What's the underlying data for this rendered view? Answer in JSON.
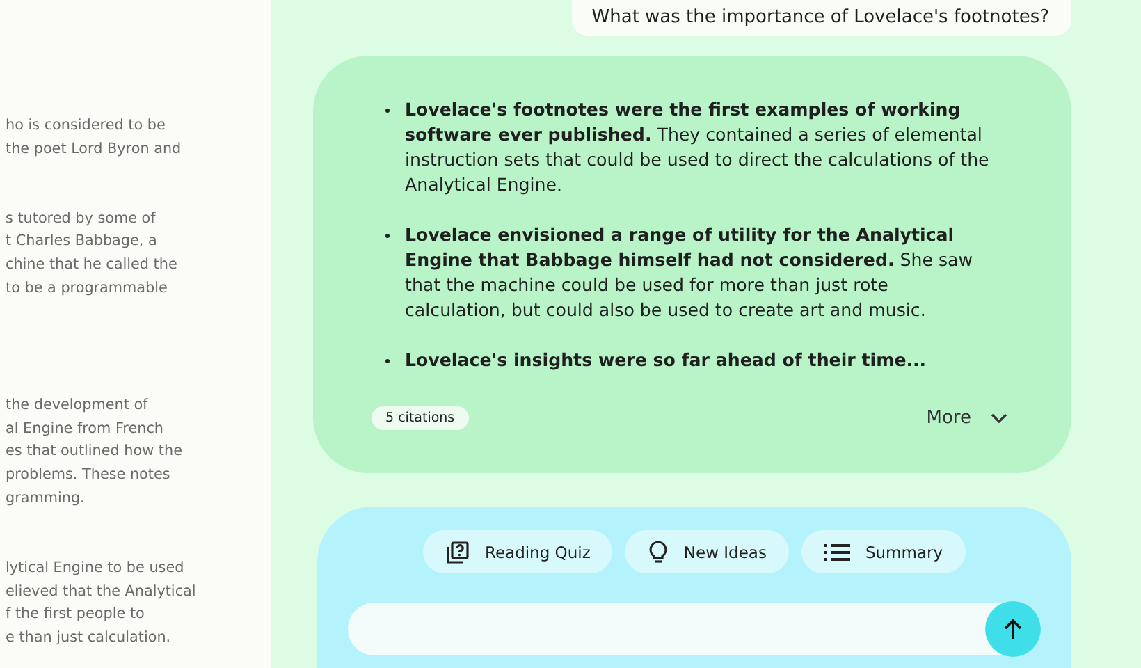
{
  "source_panel": {
    "paragraphs": [
      {
        "lines": [
          "ho is considered to be",
          "the poet Lord Byron and"
        ]
      },
      {
        "lines": [
          "s tutored by some of",
          "t Charles Babbage, a",
          "chine that he called the",
          "to be a programmable"
        ]
      },
      {
        "lines": [
          "the development of",
          "al Engine from French",
          "es that outlined how the",
          "problems. These notes",
          "gramming."
        ]
      },
      {
        "lines": [
          "lytical Engine to be used",
          "elieved that the Analytical",
          "f the first people to",
          "e than just calculation."
        ]
      }
    ]
  },
  "chat": {
    "question": "What was the importance of Lovelace's footnotes?",
    "answer": {
      "bullets": [
        "**Lovelace's footnotes were the first examples of working software ever published.** They contained a series of elemental instruction sets that could be used to direct the calculations of the Analytical Engine.",
        "**Lovelace envisioned a range of utility for the Analytical Engine that Babbage himself had not considered.** She saw that the machine could be used for more than just rote calculation, but could also be used to create art and music.",
        "**Lovelace's insights were so far ahead of their time...**"
      ],
      "citations": "5 citations",
      "more": "More"
    }
  },
  "composer": {
    "suggestions": [
      {
        "kind": "quiz",
        "label": "Reading Quiz"
      },
      {
        "kind": "ideas",
        "label": "New Ideas"
      },
      {
        "kind": "summary",
        "label": "Summary"
      }
    ]
  }
}
